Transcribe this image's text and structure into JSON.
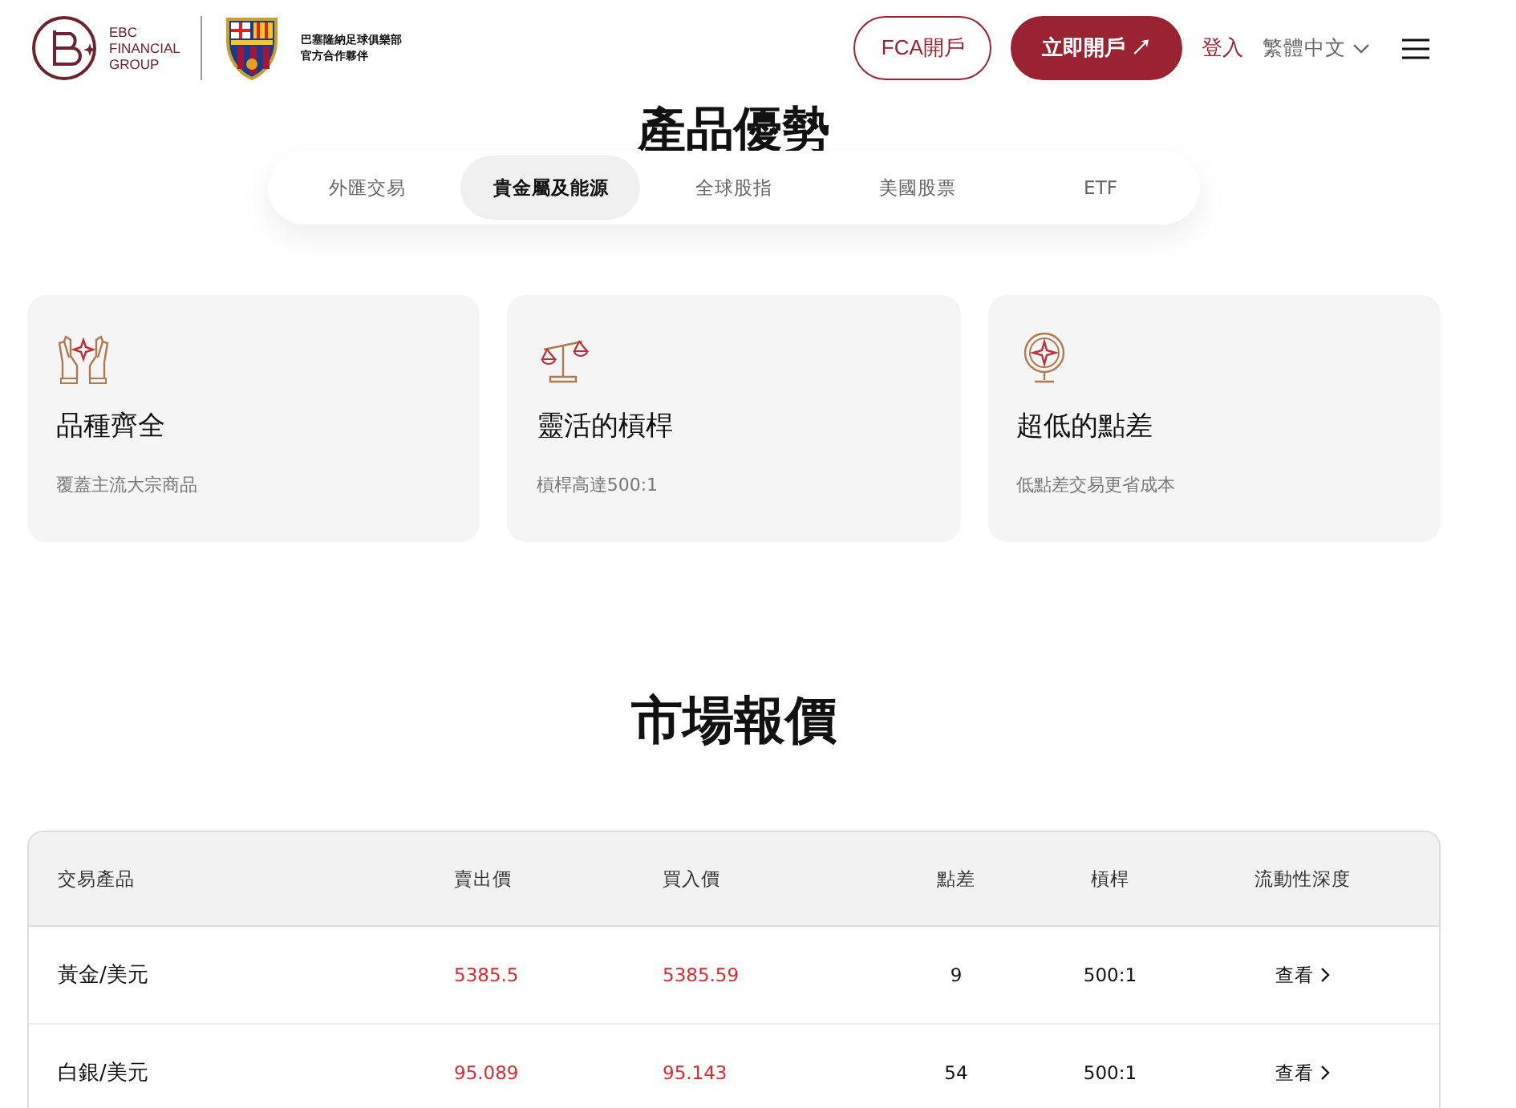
{
  "header": {
    "brand_lines": [
      "EBC",
      "FINANCIAL",
      "GROUP"
    ],
    "partner_lines": [
      "巴塞隆納足球俱樂部",
      "官方合作夥伴"
    ],
    "buttons": [
      {
        "label": "FCA開戶",
        "kind": "outline"
      },
      {
        "label": "立即開戶 ↗",
        "kind": "filled"
      }
    ],
    "login": "登入",
    "language": "繁體中文"
  },
  "advantages": {
    "title": "產品優勢",
    "tabs": [
      {
        "label": "外匯交易",
        "selected": false
      },
      {
        "label": "貴金屬及能源",
        "selected": true
      },
      {
        "label": "全球股指",
        "selected": false
      },
      {
        "label": "美國股票",
        "selected": false
      },
      {
        "label": "ETF",
        "selected": false
      }
    ],
    "cards": [
      {
        "title": "品種齊全",
        "text": "覆蓋主流大宗商品"
      },
      {
        "title": "靈活的槓桿",
        "text": "槓桿高達500:1"
      },
      {
        "title": "超低的點差",
        "text": "低點差交易更省成本"
      }
    ]
  },
  "quotes": {
    "title": "市場報價",
    "columns": [
      "交易產品",
      "賣出價",
      "買入價",
      "點差",
      "槓桿",
      "流動性深度"
    ],
    "rows": [
      {
        "product": "黃金/美元",
        "sell": "5385.5",
        "buy": "5385.59",
        "spread": "9",
        "leverage": "500:1",
        "action": "查看"
      },
      {
        "product": "白銀/美元",
        "sell": "95.089",
        "buy": "95.143",
        "spread": "54",
        "leverage": "500:1",
        "action": "查看"
      }
    ]
  }
}
